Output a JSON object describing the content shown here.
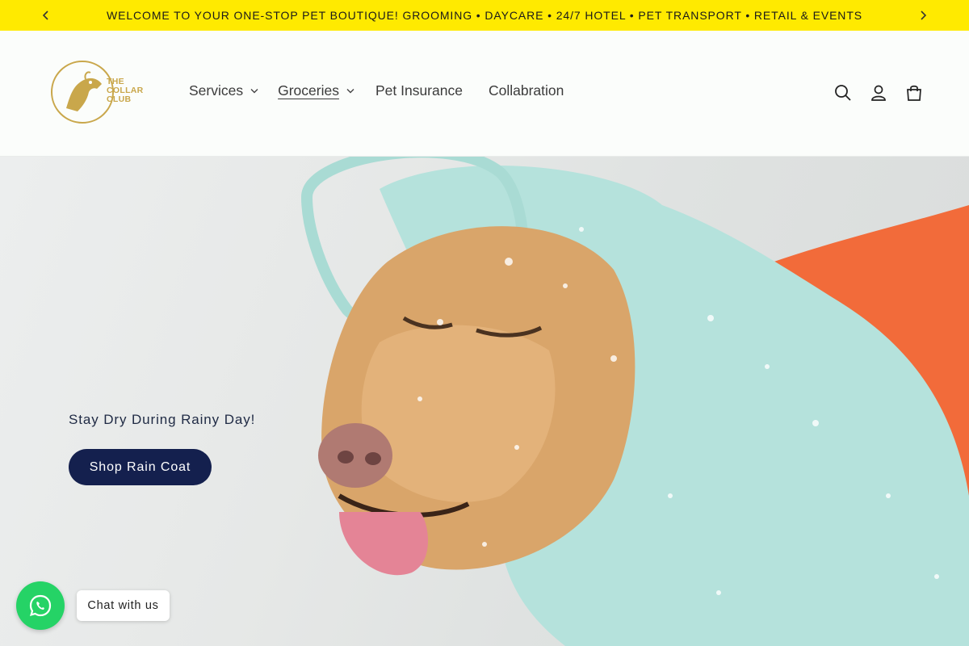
{
  "announcement": {
    "text": "WELCOME TO YOUR ONE-STOP PET BOUTIQUE! GROOMING • DAYCARE • 24/7 HOTEL • PET TRANSPORT • RETAIL & EVENTS",
    "background": "#ffea00"
  },
  "header": {
    "logo_text": [
      "THE",
      "COLLAR",
      "CLUB"
    ],
    "logo_color": "#c9a74b",
    "nav": [
      {
        "label": "Services",
        "has_dropdown": true
      },
      {
        "label": "Groceries",
        "has_dropdown": true,
        "active": true
      },
      {
        "label": "Pet Insurance",
        "has_dropdown": false
      },
      {
        "label": "Collabration",
        "has_dropdown": false
      }
    ],
    "icons": [
      "search-icon",
      "account-icon",
      "cart-icon"
    ]
  },
  "hero": {
    "subtitle": "Stay Dry During Rainy Day!",
    "button_label": "Shop Rain Coat",
    "button_color": "#14204e"
  },
  "chat": {
    "label": "Chat with us",
    "bubble_color": "#25d366"
  }
}
